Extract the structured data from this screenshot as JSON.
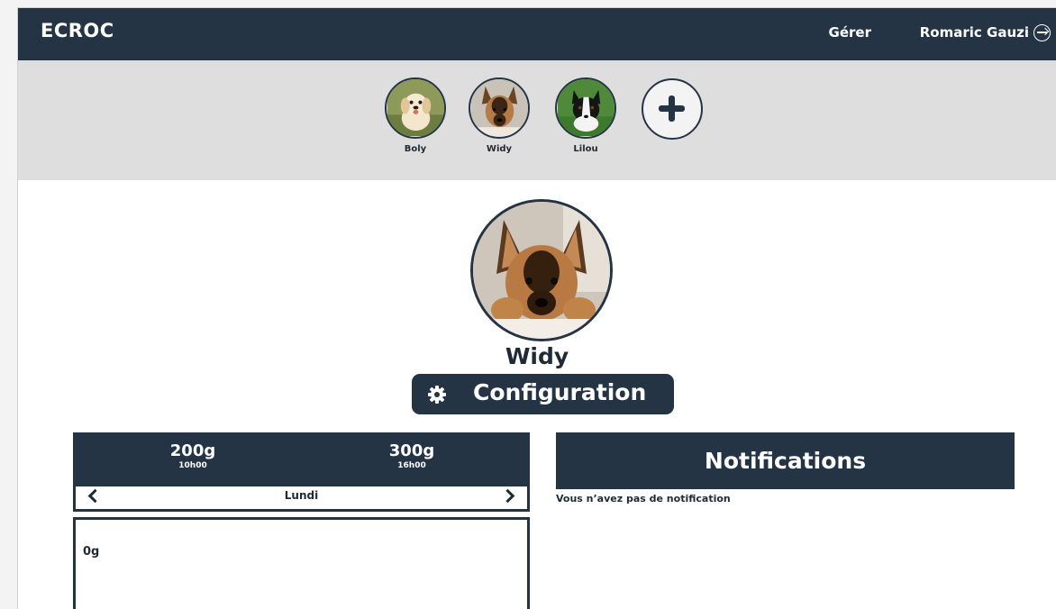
{
  "header": {
    "brand": "ECROC",
    "manage_label": "Gérer",
    "user_name": "Romaric Gauzi",
    "logout_icon": "logout-icon"
  },
  "pets": [
    {
      "name": "Boly"
    },
    {
      "name": "Widy"
    },
    {
      "name": "Lilou"
    }
  ],
  "add_pet_icon": "plus-icon",
  "selected_pet": {
    "name": "Widy",
    "config_label": "Configuration",
    "config_icon": "gear-icon"
  },
  "schedule": {
    "meals": [
      {
        "quantity": "200g",
        "time": "10h00"
      },
      {
        "quantity": "300g",
        "time": "16h00"
      }
    ],
    "day": "Lundi",
    "total": "0g"
  },
  "notifications": {
    "title": "Notifications",
    "empty_message": "Vous n’avez pas de notification"
  },
  "colors": {
    "primary": "#243444",
    "strip_bg": "#dedede",
    "page_bg": "#ffffff"
  }
}
